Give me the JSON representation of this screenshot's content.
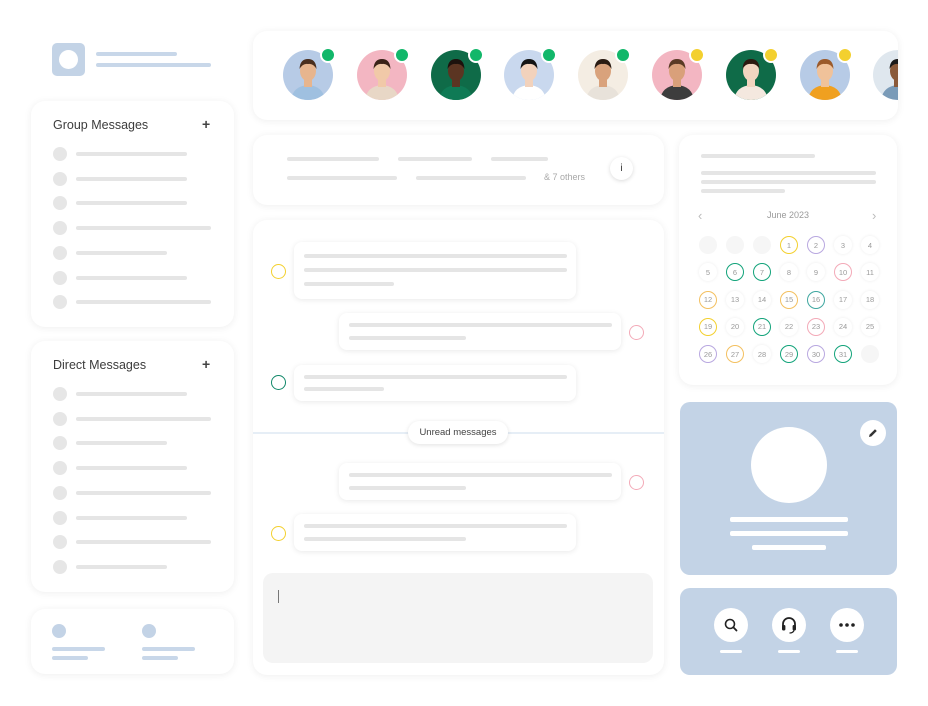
{
  "sidebar": {
    "group_title": "Group Messages",
    "group_add": "+",
    "direct_title": "Direct Messages",
    "direct_add": "+"
  },
  "contacts": [
    {
      "name": "contact-1",
      "status": "online",
      "bg": "#b7cbe6",
      "skin": "#e7b58e",
      "hair": "#4a2f1e",
      "shirt": "#9fc0e0"
    },
    {
      "name": "contact-2",
      "status": "online",
      "bg": "#f3b6c2",
      "skin": "#f1c9a8",
      "hair": "#3b2318",
      "shirt": "#e8d7c6"
    },
    {
      "name": "contact-3",
      "status": "online",
      "bg": "#0f6b48",
      "skin": "#5b3522",
      "hair": "#1c120d",
      "shirt": "#0f7a55"
    },
    {
      "name": "contact-4",
      "status": "online",
      "bg": "#c9d8ee",
      "skin": "#f2d2bc",
      "hair": "#151515",
      "shirt": "#ffffff"
    },
    {
      "name": "contact-5",
      "status": "online",
      "bg": "#f4ede3",
      "skin": "#d9a27c",
      "hair": "#2a1b12",
      "shirt": "#e8e2da"
    },
    {
      "name": "contact-6",
      "status": "away",
      "bg": "#f3b6c2",
      "skin": "#d9a07a",
      "hair": "#5a3a25",
      "shirt": "#3d3d3d"
    },
    {
      "name": "contact-7",
      "status": "away",
      "bg": "#0f6b48",
      "skin": "#f1d5c0",
      "hair": "#2b1a10",
      "shirt": "#f4e8df"
    },
    {
      "name": "contact-8",
      "status": "away",
      "bg": "#b7cbe6",
      "skin": "#f0c29a",
      "hair": "#9b5a2a",
      "shirt": "#f0a020"
    },
    {
      "name": "contact-9",
      "status": "none",
      "bg": "#dfe7ee",
      "skin": "#8a5a3a",
      "hair": "#1a1a1a",
      "shirt": "#7a9bb8"
    }
  ],
  "status_colors": {
    "online": "#12b76a",
    "away": "#f3d02f"
  },
  "conversation": {
    "others_label": "& 7 others",
    "info_icon": "i",
    "unread_label": "Unread messages"
  },
  "calendar": {
    "month_label": "June 2023",
    "prev_icon": "‹",
    "next_icon": "›",
    "leading_blanks": 3,
    "days": [
      {
        "d": "1",
        "ring": "#f3d02f"
      },
      {
        "d": "2",
        "ring": "#b9a8e0"
      },
      {
        "d": "3",
        "ring": ""
      },
      {
        "d": "4",
        "ring": ""
      },
      {
        "d": "5",
        "ring": ""
      },
      {
        "d": "6",
        "ring": "#12a37a"
      },
      {
        "d": "7",
        "ring": "#12a37a"
      },
      {
        "d": "8",
        "ring": ""
      },
      {
        "d": "9",
        "ring": ""
      },
      {
        "d": "10",
        "ring": "#f3aab8"
      },
      {
        "d": "11",
        "ring": ""
      },
      {
        "d": "12",
        "ring": "#f3c060"
      },
      {
        "d": "13",
        "ring": ""
      },
      {
        "d": "14",
        "ring": ""
      },
      {
        "d": "15",
        "ring": "#f3c060"
      },
      {
        "d": "16",
        "ring": "#3fa7a0"
      },
      {
        "d": "17",
        "ring": ""
      },
      {
        "d": "18",
        "ring": ""
      },
      {
        "d": "19",
        "ring": "#f3d02f"
      },
      {
        "d": "20",
        "ring": ""
      },
      {
        "d": "21",
        "ring": "#12a37a"
      },
      {
        "d": "22",
        "ring": ""
      },
      {
        "d": "23",
        "ring": "#f3aab8"
      },
      {
        "d": "24",
        "ring": ""
      },
      {
        "d": "25",
        "ring": ""
      },
      {
        "d": "26",
        "ring": "#b9a8e0"
      },
      {
        "d": "27",
        "ring": "#f3c060"
      },
      {
        "d": "28",
        "ring": ""
      },
      {
        "d": "29",
        "ring": "#12a37a"
      },
      {
        "d": "30",
        "ring": "#b9a8e0"
      },
      {
        "d": "31",
        "ring": "#12a37a"
      }
    ]
  },
  "profile": {
    "accent": "#c3d3e6",
    "edit_icon": "pencil-icon"
  },
  "actions": [
    {
      "name": "search-button",
      "icon": "search-icon"
    },
    {
      "name": "support-button",
      "icon": "headset-icon"
    },
    {
      "name": "more-button",
      "icon": "more-icon"
    }
  ]
}
